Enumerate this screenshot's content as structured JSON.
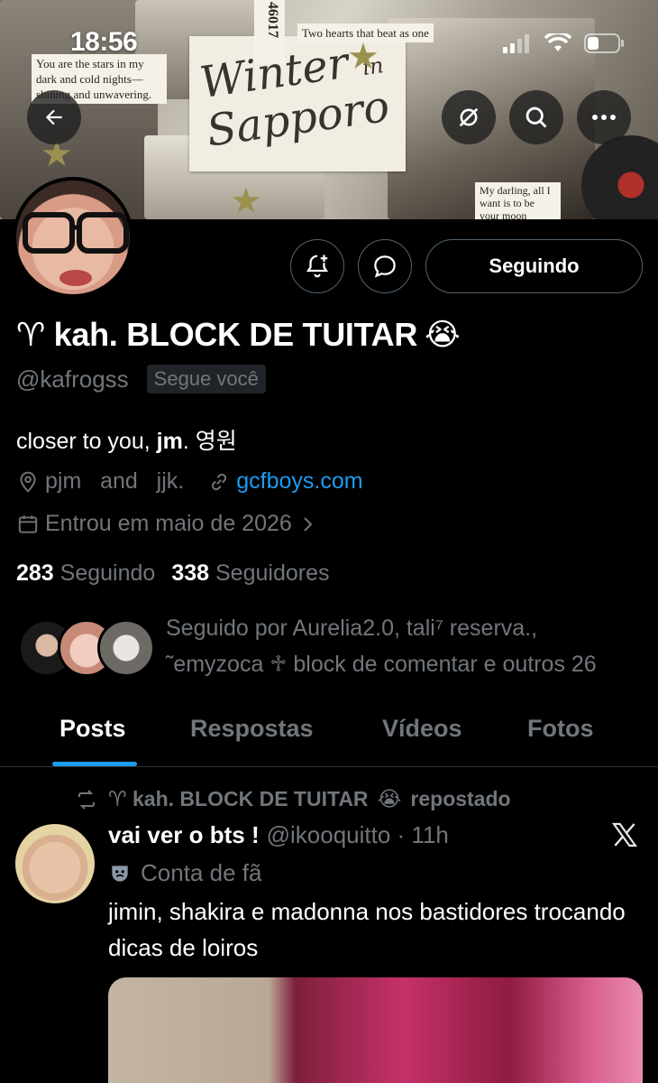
{
  "status_bar": {
    "time": "18:56"
  },
  "banner": {
    "title_line1": "Winter",
    "title_in": "in",
    "title_line2": "Sapporo",
    "note_left": "You are the stars in my dark and cold nights—shining and unwavering.",
    "note_top": "Two hearts that beat as one",
    "ticket_number": "46017",
    "note_bottom": "My darling, all I want is to be your moon"
  },
  "profile": {
    "name": "♈︎ kah. BLOCK DE TUITAR",
    "name_emoji": "😭",
    "handle": "@kafrogss",
    "follows_you": "Segue você",
    "bio_prefix": "closer to you, ",
    "bio_bold": "jm",
    "bio_suffix": ". 영원",
    "location": "pjm   and   jjk.",
    "website": "gcfboys.com",
    "joined": "Entrou em maio de 2026",
    "following_count": "283",
    "following_label": "Seguindo",
    "followers_count": "338",
    "followers_label": "Seguidores",
    "followed_by_line1": "Seguido por Aurelia2.0, tali⁷ reserva.,",
    "followed_by_line2": "˜emyzoca ♱ block de comentar e outros 26",
    "follow_button": "Seguindo"
  },
  "tabs": [
    "Posts",
    "Respostas",
    "Vídeos",
    "Fotos"
  ],
  "post": {
    "repost_label": "♈︎ kah. BLOCK DE TUITAR",
    "repost_emoji": "😭",
    "repost_suffix": "repostado",
    "author": "vai ver o bts !",
    "handle_time": "@ikooquitto · 11h",
    "fan_label": "Conta de fã",
    "text": "jimin, shakira e madonna nos bastidores trocando dicas de loiros"
  },
  "colors": {
    "accent": "#1d9bf0",
    "muted": "#71767b",
    "background": "#000000"
  },
  "icons": [
    "back-arrow-icon",
    "refresh-icon",
    "search-icon",
    "more-icon",
    "notification-add-icon",
    "message-icon",
    "location-icon",
    "link-icon",
    "calendar-icon",
    "chevron-right-icon",
    "repost-icon",
    "theater-mask-icon",
    "x-logo-icon"
  ]
}
